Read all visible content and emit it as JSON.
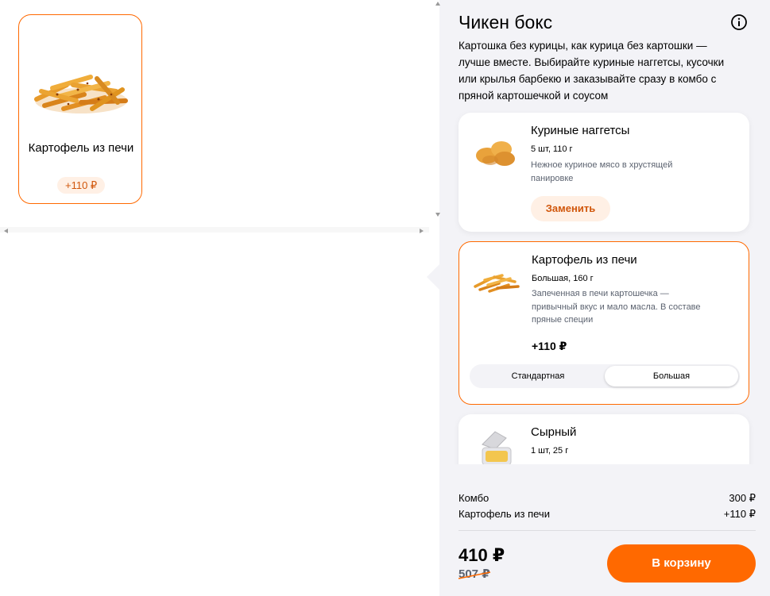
{
  "option": {
    "name": "Картофель из печи",
    "price": "+110 ₽"
  },
  "panel": {
    "title": "Чикен бокс",
    "info_icon": "info-icon",
    "description": "Картошка без курицы, как курица без картошки — лучше вместе. Выбирайте куриные наггетсы, кусочки или крылья барбекю и заказывайте сразу в комбо с пряной картошечкой и соусом"
  },
  "items": [
    {
      "name": "Куриные наггетсы",
      "weight": "5 шт, 110 г",
      "description": "Нежное куриное мясо в хрустящей панировке",
      "action_label": "Заменить"
    },
    {
      "name": "Картофель из печи",
      "weight": "Большая, 160 г",
      "description": "Запеченная в печи картошечка — привычный вкус и мало масла. В составе пряные специи",
      "price": "+110 ₽",
      "sizes": [
        "Стандартная",
        "Большая"
      ],
      "selected_size": "Большая"
    },
    {
      "name": "Сырный",
      "weight": "1 шт, 25 г"
    }
  ],
  "summary": {
    "rows": [
      {
        "label": "Комбо",
        "value": "300 ₽"
      },
      {
        "label": "Картофель из печи",
        "value": "+110 ₽"
      }
    ],
    "total": "410 ₽",
    "old_price": "507 ₽",
    "cart_button": "В корзину"
  },
  "colors": {
    "accent": "#ff6900",
    "accent_light": "#fff0e5",
    "panel_bg": "#f3f3f7"
  }
}
